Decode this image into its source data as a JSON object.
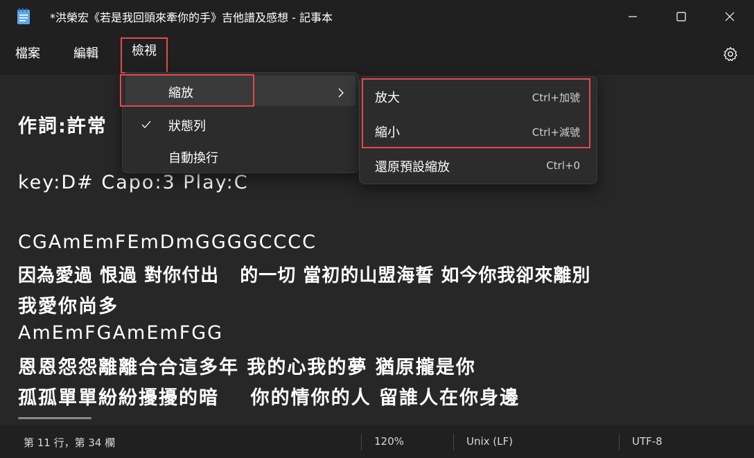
{
  "window": {
    "title": "*洪榮宏《若是我回頭來牽你的手》吉他譜及感想 - 記事本"
  },
  "menu": {
    "file": "檔案",
    "edit": "編輯",
    "view": "檢視"
  },
  "view_menu": {
    "items": [
      {
        "label": "縮放",
        "checked": false,
        "has_submenu": true
      },
      {
        "label": "狀態列",
        "checked": true,
        "has_submenu": false
      },
      {
        "label": "自動換行",
        "checked": false,
        "has_submenu": false
      }
    ]
  },
  "zoom_submenu": {
    "items": [
      {
        "label": "放大",
        "shortcut": "Ctrl+加號"
      },
      {
        "label": "縮小",
        "shortcut": "Ctrl+減號"
      },
      {
        "label": "還原預設縮放",
        "shortcut": "Ctrl+0"
      }
    ]
  },
  "editor": {
    "lines": [
      "作詞:許常",
      "",
      "key:D# Capo:3 Play:C",
      "",
      "CGAmEmFEmDmGGGGCCCC",
      "因為愛過 恨過 對你付出   的一切 當初的山盟海誓 如今你我卻來離別",
      "我愛你尚多",
      "AmEmFGAmEmFGG",
      "恩恩怨怨離離合合這多年 我的心我的夢 猶原攏是你",
      "孤孤單單紛紛擾擾的暗    你的情你的人 留誰人在你身邊"
    ]
  },
  "statusbar": {
    "position": "第 11 行，第 34 欄",
    "zoom": "120%",
    "line_ending": "Unix (LF)",
    "encoding": "UTF-8"
  },
  "colors": {
    "highlight": "#e8484d",
    "background": "#202020",
    "editor_bg": "#272727",
    "menu_bg": "#2c2c2c"
  },
  "icons": [
    "notepad-icon",
    "minimize-icon",
    "maximize-icon",
    "close-icon",
    "gear-icon",
    "check-icon",
    "chevron-right-icon"
  ]
}
